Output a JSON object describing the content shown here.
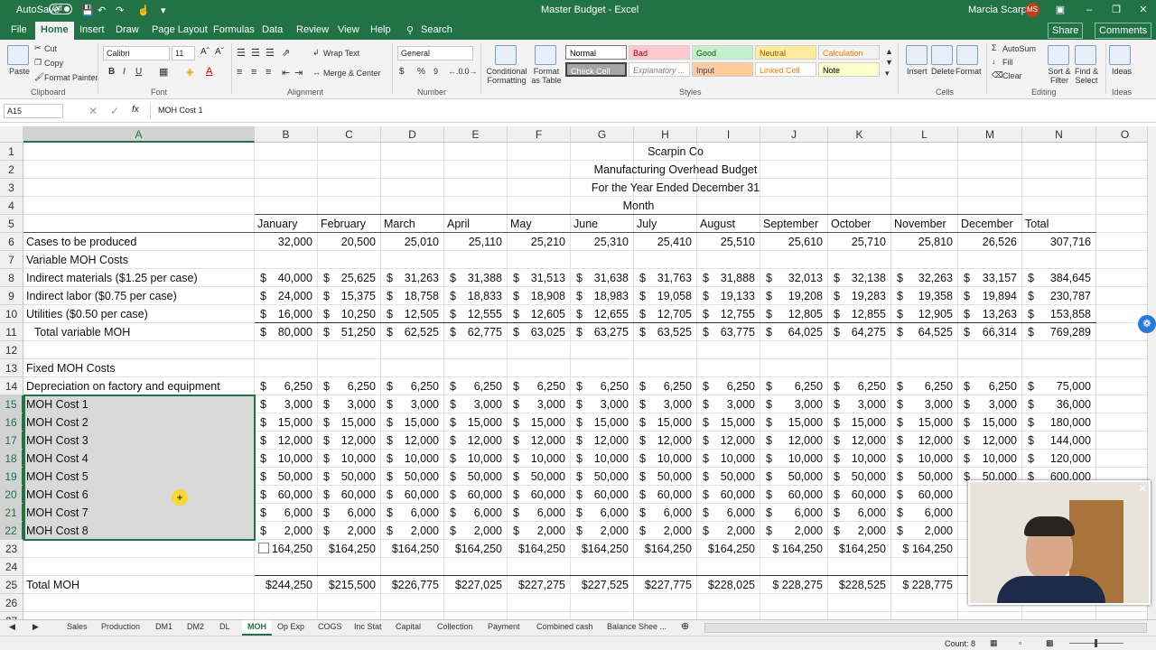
{
  "app": {
    "autosave_label": "AutoSave",
    "autosave_state": "Off",
    "window_title": "Master Budget  -  Excel",
    "user_name": "Marcia Scarpin",
    "user_initials": "MS"
  },
  "menu": {
    "tabs": [
      "File",
      "Home",
      "Insert",
      "Draw",
      "Page Layout",
      "Formulas",
      "Data",
      "Review",
      "View",
      "Help"
    ],
    "active_tab": "Home",
    "search_label": "Search",
    "share_label": "Share",
    "comments_label": "Comments"
  },
  "ribbon": {
    "paste_label": "Paste",
    "cut_label": "Cut",
    "copy_label": "Copy",
    "format_painter_label": "Format Painter",
    "clipboard_group": "Clipboard",
    "font_name": "Calibri",
    "font_size": "11",
    "font_group": "Font",
    "wrap_text_label": "Wrap Text",
    "merge_center_label": "Merge & Center",
    "alignment_group": "Alignment",
    "number_format": "General",
    "number_group": "Number",
    "conditional_formatting_label": "Conditional Formatting",
    "format_as_table_label": "Format as Table",
    "styles": [
      {
        "label": "Normal",
        "bg": "#ffffff",
        "fg": "#000000"
      },
      {
        "label": "Bad",
        "bg": "#ffc7ce",
        "fg": "#9c0006"
      },
      {
        "label": "Good",
        "bg": "#c6efce",
        "fg": "#006100"
      },
      {
        "label": "Neutral",
        "bg": "#ffeb9c",
        "fg": "#9c5700"
      },
      {
        "label": "Calculation",
        "bg": "#f2f2f2",
        "fg": "#fa7d00"
      },
      {
        "label": "Check Cell",
        "bg": "#a5a5a5",
        "fg": "#ffffff"
      },
      {
        "label": "Explanatory ...",
        "bg": "#ffffff",
        "fg": "#7f7f7f"
      },
      {
        "label": "Input",
        "bg": "#ffcc99",
        "fg": "#3f3f76"
      },
      {
        "label": "Linked Cell",
        "bg": "#ffffff",
        "fg": "#fa7d00"
      },
      {
        "label": "Note",
        "bg": "#ffffcc",
        "fg": "#000000"
      }
    ],
    "styles_group": "Styles",
    "insert_label": "Insert",
    "delete_label": "Delete",
    "format_label": "Format",
    "cells_group": "Cells",
    "autosum_label": "AutoSum",
    "fill_label": "Fill",
    "clear_label": "Clear",
    "sort_filter_label": "Sort & Filter",
    "find_select_label": "Find & Select",
    "editing_group": "Editing",
    "ideas_label": "Ideas",
    "ideas_group": "Ideas"
  },
  "formula_bar": {
    "name_box": "A15",
    "fx_label": "fx",
    "content": "MOH Cost 1"
  },
  "columns": [
    "A",
    "B",
    "C",
    "D",
    "E",
    "F",
    "G",
    "H",
    "I",
    "J",
    "K",
    "L",
    "M",
    "N",
    "O"
  ],
  "selected_column": "A",
  "titles": {
    "company": "Scarpin Co",
    "report": "Manufacturing Overhead Budget",
    "period": "For the Year Ended December 31",
    "month_header": "Month"
  },
  "months": [
    "January",
    "February",
    "March",
    "April",
    "May",
    "June",
    "July",
    "August",
    "September",
    "October",
    "November",
    "December",
    "Total"
  ],
  "rows": [
    {
      "r": "6",
      "label": "Cases to be produced",
      "values": [
        "32,000",
        "20,500",
        "25,010",
        "25,110",
        "25,210",
        "25,310",
        "25,410",
        "25,510",
        "25,610",
        "25,710",
        "25,810",
        "26,526",
        "307,716"
      ]
    },
    {
      "r": "7",
      "label": "Variable MOH Costs"
    },
    {
      "r": "8",
      "label": "Indirect materials ($1.25 per case)",
      "dollar": true,
      "values": [
        "40,000",
        "25,625",
        "31,263",
        "31,388",
        "31,513",
        "31,638",
        "31,763",
        "31,888",
        "32,013",
        "32,138",
        "32,263",
        "33,157",
        "384,645"
      ]
    },
    {
      "r": "9",
      "label": "Indirect labor ($0.75 per case)",
      "dollar": true,
      "values": [
        "24,000",
        "15,375",
        "18,758",
        "18,833",
        "18,908",
        "18,983",
        "19,058",
        "19,133",
        "19,208",
        "19,283",
        "19,358",
        "19,894",
        "230,787"
      ]
    },
    {
      "r": "10",
      "label": "Utilities ($0.50 per case)",
      "dollar": true,
      "values": [
        "16,000",
        "10,250",
        "12,505",
        "12,555",
        "12,605",
        "12,655",
        "12,705",
        "12,755",
        "12,805",
        "12,855",
        "12,905",
        "13,263",
        "153,858"
      ]
    },
    {
      "r": "11",
      "label": "Total variable MOH",
      "indent": true,
      "dollar": true,
      "values": [
        "80,000",
        "51,250",
        "62,525",
        "62,775",
        "63,025",
        "63,275",
        "63,525",
        "63,775",
        "64,025",
        "64,275",
        "64,525",
        "66,314",
        "769,289"
      ]
    },
    {
      "r": "12"
    },
    {
      "r": "13",
      "label": "Fixed MOH Costs"
    },
    {
      "r": "14",
      "label": "Depreciation on factory and equipment",
      "dollar": true,
      "values": [
        "6,250",
        "6,250",
        "6,250",
        "6,250",
        "6,250",
        "6,250",
        "6,250",
        "6,250",
        "6,250",
        "6,250",
        "6,250",
        "6,250",
        "75,000"
      ]
    },
    {
      "r": "15",
      "label": "MOH Cost 1",
      "sel": true,
      "dollar": true,
      "values": [
        "3,000",
        "3,000",
        "3,000",
        "3,000",
        "3,000",
        "3,000",
        "3,000",
        "3,000",
        "3,000",
        "3,000",
        "3,000",
        "3,000",
        "36,000"
      ]
    },
    {
      "r": "16",
      "label": "MOH Cost 2",
      "sel": true,
      "dollar": true,
      "values": [
        "15,000",
        "15,000",
        "15,000",
        "15,000",
        "15,000",
        "15,000",
        "15,000",
        "15,000",
        "15,000",
        "15,000",
        "15,000",
        "15,000",
        "180,000"
      ]
    },
    {
      "r": "17",
      "label": "MOH Cost 3",
      "sel": true,
      "dollar": true,
      "values": [
        "12,000",
        "12,000",
        "12,000",
        "12,000",
        "12,000",
        "12,000",
        "12,000",
        "12,000",
        "12,000",
        "12,000",
        "12,000",
        "12,000",
        "144,000"
      ]
    },
    {
      "r": "18",
      "label": "MOH Cost 4",
      "sel": true,
      "dollar": true,
      "values": [
        "10,000",
        "10,000",
        "10,000",
        "10,000",
        "10,000",
        "10,000",
        "10,000",
        "10,000",
        "10,000",
        "10,000",
        "10,000",
        "10,000",
        "120,000"
      ]
    },
    {
      "r": "19",
      "label": "MOH Cost 5",
      "sel": true,
      "dollar": true,
      "values": [
        "50,000",
        "50,000",
        "50,000",
        "50,000",
        "50,000",
        "50,000",
        "50,000",
        "50,000",
        "50,000",
        "50,000",
        "50,000",
        "50,000",
        "600,000"
      ]
    },
    {
      "r": "20",
      "label": "MOH Cost 6",
      "sel": true,
      "dollar": true,
      "values": [
        "60,000",
        "60,000",
        "60,000",
        "60,000",
        "60,000",
        "60,000",
        "60,000",
        "60,000",
        "60,000",
        "60,000",
        "60,000",
        "",
        ""
      ]
    },
    {
      "r": "21",
      "label": "MOH Cost 7",
      "sel": true,
      "dollar": true,
      "values": [
        "6,000",
        "6,000",
        "6,000",
        "6,000",
        "6,000",
        "6,000",
        "6,000",
        "6,000",
        "6,000",
        "6,000",
        "6,000",
        "",
        ""
      ]
    },
    {
      "r": "22",
      "label": "MOH Cost 8",
      "sel": true,
      "dollar": true,
      "values": [
        "2,000",
        "2,000",
        "2,000",
        "2,000",
        "2,000",
        "2,000",
        "2,000",
        "2,000",
        "2,000",
        "2,000",
        "2,000",
        "",
        ""
      ]
    },
    {
      "r": "23",
      "label": "",
      "values": [
        "164,250",
        "$164,250",
        "$164,250",
        "$164,250",
        "$164,250",
        "$164,250",
        "$164,250",
        "$164,250",
        "$ 164,250",
        "$164,250",
        "$ 164,250",
        "",
        ""
      ]
    },
    {
      "r": "24"
    },
    {
      "r": "25",
      "label": "Total MOH",
      "values": [
        "$244,250",
        "$215,500",
        "$226,775",
        "$227,025",
        "$227,275",
        "$227,525",
        "$227,775",
        "$228,025",
        "$ 228,275",
        "$228,525",
        "$ 228,775",
        "",
        ""
      ]
    },
    {
      "r": "26"
    }
  ],
  "sheet_tabs": [
    "Sales",
    "Production",
    "DM1",
    "DM2",
    "DL",
    "MOH",
    "Op Exp",
    "COGS",
    "Inc Stat",
    "Capital",
    "Collection",
    "Payment",
    "Combined cash",
    "Balance Shee ..."
  ],
  "active_sheet": "MOH",
  "status": {
    "count_label": "Count: 8"
  },
  "colors": {
    "excel_green": "#217346",
    "selection_gray": "#d9d9d9"
  }
}
